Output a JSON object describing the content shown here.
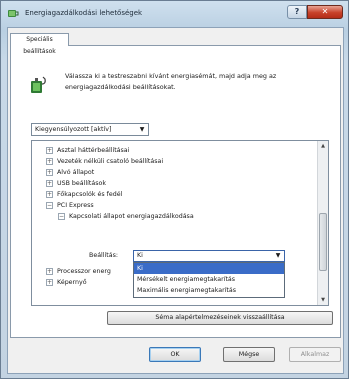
{
  "window": {
    "title": "Energiagazdálkodási lehetőségek",
    "help_glyph": "?",
    "close_glyph": "✕",
    "tab_label": "Speciális beállítások"
  },
  "main": {
    "description": "Válassza ki a testreszabni kívánt energiasémát, majd adja meg az energiagazdálkodási beállításokat.",
    "plan_value": "Kiegyensúlyozott [aktív]"
  },
  "tree": {
    "items": [
      {
        "expander": "+",
        "label": "Asztal háttérbeállításai"
      },
      {
        "expander": "+",
        "label": "Vezeték nélküli csatoló beállításai"
      },
      {
        "expander": "+",
        "label": "Alvó állapot"
      },
      {
        "expander": "+",
        "label": "USB beállítások"
      },
      {
        "expander": "+",
        "label": "Főkapcsolók és fedél"
      },
      {
        "expander": "−",
        "label": "PCI Express"
      },
      {
        "expander": "−",
        "label": "Kapcsolati állapot energiagazdálkodása"
      },
      {
        "expander": "+",
        "label": "Processzor energ"
      },
      {
        "expander": "+",
        "label": "Képernyő"
      }
    ],
    "setting_label": "Beállítás:",
    "combo_value": "Ki",
    "dropdown_options": [
      "Ki",
      "Mérsékelt energiamegtakarítás",
      "Maximális energiamegtakarítás"
    ],
    "scroll_up": "▲",
    "scroll_down": "▼"
  },
  "buttons": {
    "restore": "Séma alapértelmezéseinek visszaállítása",
    "ok": "OK",
    "cancel": "Mégse",
    "apply": "Alkalmaz"
  },
  "icons": {
    "dropdown_arrow": "▼"
  },
  "colors": {
    "selection": "#3a6cc8",
    "close_button": "#c8412a"
  }
}
